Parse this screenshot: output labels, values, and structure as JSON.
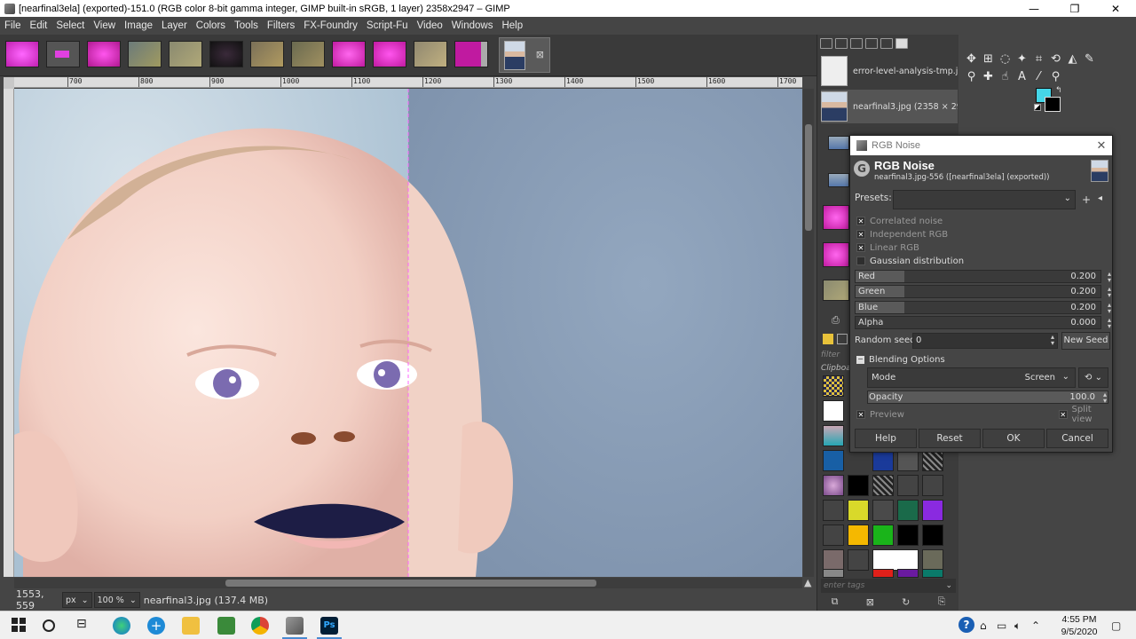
{
  "window": {
    "title": "[nearfinal3ela] (exported)-151.0 (RGB color 8-bit gamma integer, GIMP built-in sRGB, 1 layer) 2358x2947 – GIMP",
    "minimize": "—",
    "maximize": "❐",
    "close": "✕"
  },
  "menu": [
    "File",
    "Edit",
    "Select",
    "View",
    "Image",
    "Layer",
    "Colors",
    "Tools",
    "Filters",
    "FX-Foundry",
    "Script-Fu",
    "Video",
    "Windows",
    "Help"
  ],
  "image_tabs": {
    "close": "⊠"
  },
  "ruler": {
    "labels": [
      "700",
      "800",
      "900",
      "1000",
      "1100",
      "1200",
      "1300",
      "1400",
      "1500",
      "1600",
      "1700"
    ]
  },
  "status": {
    "coords": "1553, 559",
    "unit": "px",
    "zoom": "100 %",
    "file": "nearfinal3.jpg (137.4 MB)"
  },
  "dock": {
    "documents": [
      {
        "label": "error-level-analysis-tmp.jpg"
      },
      {
        "label": "nearfinal3.jpg (2358 × 29"
      }
    ],
    "filter": "filter",
    "clipboard": "Clipboard",
    "tags": "enter tags"
  },
  "dialog": {
    "window_title": "RGB Noise",
    "title": "RGB Noise",
    "subtitle": "nearfinal3.jpg-556 ([nearfinal3ela] (exported))",
    "presets_label": "Presets:",
    "checks": [
      {
        "label": "Correlated noise",
        "checked": true
      },
      {
        "label": "Independent RGB",
        "checked": true
      },
      {
        "label": "Linear RGB",
        "checked": true
      },
      {
        "label": "Gaussian distribution",
        "checked": false
      }
    ],
    "sliders": [
      {
        "label": "Red",
        "value": "0.200"
      },
      {
        "label": "Green",
        "value": "0.200"
      },
      {
        "label": "Blue",
        "value": "0.200"
      },
      {
        "label": "Alpha",
        "value": "0.000"
      }
    ],
    "seed_label": "Random seed",
    "seed_value": "0",
    "new_seed": "New Seed",
    "blending_label": "Blending Options",
    "mode_label": "Mode",
    "mode_value": "Screen",
    "opacity_label": "Opacity",
    "opacity_value": "100.0",
    "preview_label": "Preview",
    "split_label": "Split view",
    "buttons": {
      "help": "Help",
      "reset": "Reset",
      "ok": "OK",
      "cancel": "Cancel"
    }
  },
  "taskbar": {
    "time": "4:55 PM",
    "date": "9/5/2020"
  }
}
